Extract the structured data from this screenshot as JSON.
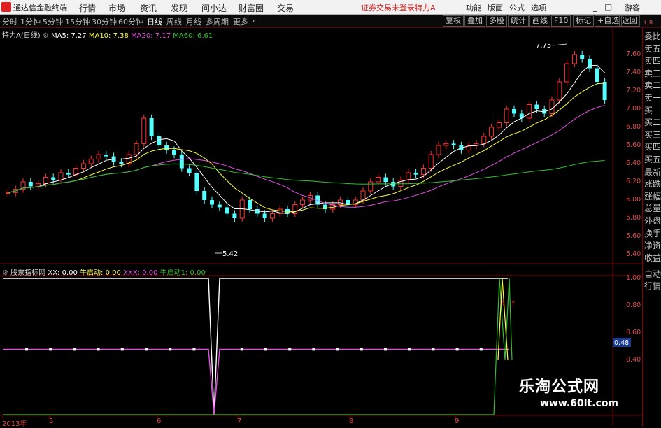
{
  "menubar": {
    "app_name": "通达信金融终端",
    "items": [
      "行情",
      "市场",
      "资讯",
      "发现",
      "问小达",
      "财富圈",
      "交易"
    ],
    "status": "证券交易未登录",
    "stock_title": "特力A",
    "right_items": [
      "功能",
      "版面",
      "公式",
      "选项"
    ],
    "window_btns": [
      "游客",
      "_",
      "□",
      "×"
    ]
  },
  "periodbar": {
    "periods": [
      "分时",
      "1分钟",
      "5分钟",
      "15分钟",
      "30分钟",
      "60分钟",
      "日线",
      "周线",
      "月线",
      "多周期",
      "更多"
    ],
    "active": "日线",
    "tools": [
      "复权",
      "叠加",
      "多股",
      "统计",
      "画线",
      "F10",
      "标记",
      "+自选",
      "返回"
    ]
  },
  "main_legend": {
    "stock": "特力A(日线)",
    "ma5": "MA5: 7.27",
    "ma10": "MA10: 7.38",
    "ma20": "MA20: 7.17",
    "ma60": "MA60: 6.61"
  },
  "annotations": {
    "high": "7.75",
    "low": "5.42"
  },
  "main_axis": [
    "7.60",
    "7.40",
    "7.20",
    "7.00",
    "6.80",
    "6.60",
    "6.40",
    "6.20",
    "6.00",
    "5.80",
    "5.60",
    "5.40"
  ],
  "indicator_legend": {
    "name": "股票指标网",
    "xx": "XX: 0.00",
    "nqd": "牛启动: 0.00",
    "xxx": "XXX: 0.00",
    "nqd1": "牛启动1: 0.00"
  },
  "indicator_axis": [
    "1.00",
    "0.80",
    "0.60",
    "0.40"
  ],
  "indicator_cursor": "0.48",
  "x_axis": [
    "2013年",
    "5",
    "6",
    "7",
    "8",
    "9"
  ],
  "side_panel": {
    "top": "L R",
    "items": [
      "委比",
      "卖五",
      "卖四",
      "卖三",
      "卖二",
      "卖一",
      "买一",
      "买二",
      "买三",
      "买四",
      "买五",
      "最新",
      "涨跌",
      "涨幅",
      "总量",
      "外盘",
      "换手",
      "净资",
      "收益"
    ],
    "bottom": [
      "自动",
      "行情"
    ]
  },
  "watermark": {
    "title": "乐淘公式网",
    "url": "www.60lt.com"
  },
  "colors": {
    "up": "#ff3030",
    "down": "#54ffff",
    "ma5": "#ffffff",
    "ma10": "#ffff40",
    "ma20": "#e050e0",
    "ma60": "#30c030",
    "axis": "#800000",
    "label": "#e04848"
  }
}
